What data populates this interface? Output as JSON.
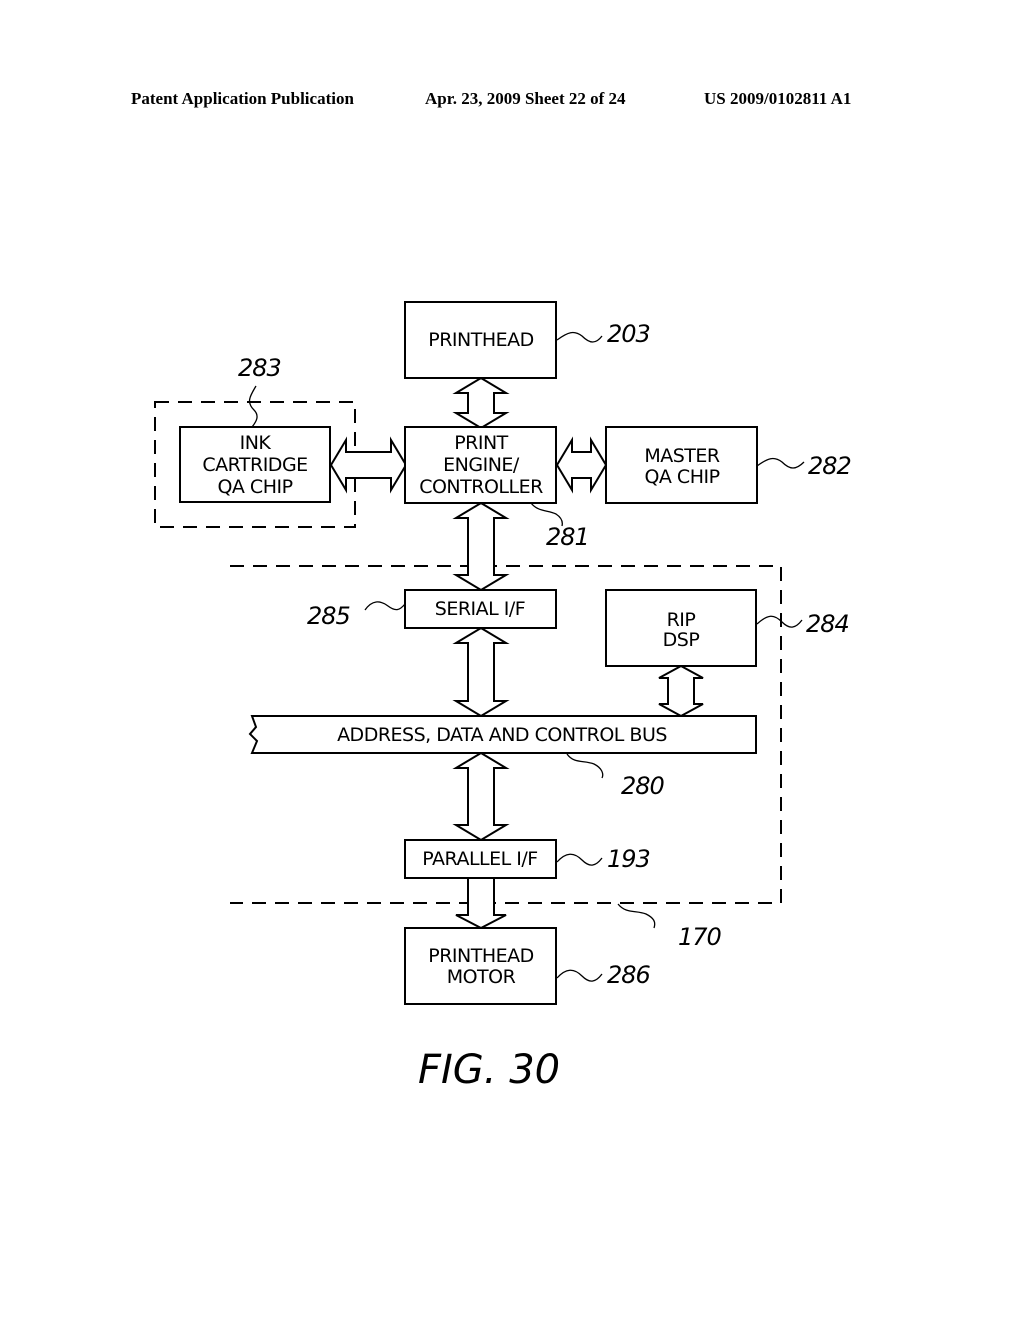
{
  "header": {
    "publication": "Patent Application Publication",
    "date_sheet": "Apr. 23, 2009  Sheet 22 of 24",
    "number": "US 2009/0102811 A1"
  },
  "diagram": {
    "blocks": {
      "printhead": {
        "lines": [
          "PRINTHEAD"
        ],
        "ref": "203"
      },
      "ink_cartridge_qa_chip": {
        "lines": [
          "INK",
          "CARTRIDGE",
          "QA CHIP"
        ],
        "ref": "283"
      },
      "print_engine_controller": {
        "lines": [
          "PRINT",
          "ENGINE/",
          "CONTROLLER"
        ],
        "ref": "281"
      },
      "master_qa_chip": {
        "lines": [
          "MASTER",
          "QA CHIP"
        ],
        "ref": "282"
      },
      "serial_if": {
        "lines": [
          "SERIAL I/F"
        ],
        "ref": "285"
      },
      "rip_dsp": {
        "lines": [
          "RIP",
          "DSP"
        ],
        "ref": "284"
      },
      "bus": {
        "lines": [
          "ADDRESS, DATA AND CONTROL BUS"
        ],
        "ref": "280"
      },
      "parallel_if": {
        "lines": [
          "PARALLEL I/F"
        ],
        "ref": "193"
      },
      "printhead_motor": {
        "lines": [
          "PRINTHEAD",
          "MOTOR"
        ],
        "ref": "286"
      }
    },
    "groups": {
      "controller_group": {
        "ref": "170"
      }
    },
    "connections": [
      {
        "from": "printhead",
        "to": "print_engine_controller",
        "type": "bidirectional"
      },
      {
        "from": "ink_cartridge_qa_chip",
        "to": "print_engine_controller",
        "type": "bidirectional"
      },
      {
        "from": "print_engine_controller",
        "to": "master_qa_chip",
        "type": "bidirectional"
      },
      {
        "from": "print_engine_controller",
        "to": "serial_if",
        "type": "bidirectional"
      },
      {
        "from": "serial_if",
        "to": "bus",
        "type": "bidirectional"
      },
      {
        "from": "rip_dsp",
        "to": "bus",
        "type": "bidirectional"
      },
      {
        "from": "bus",
        "to": "parallel_if",
        "type": "bidirectional"
      },
      {
        "from": "parallel_if",
        "to": "printhead_motor",
        "type": "unidirectional"
      }
    ],
    "figure_caption": "FIG. 30"
  }
}
